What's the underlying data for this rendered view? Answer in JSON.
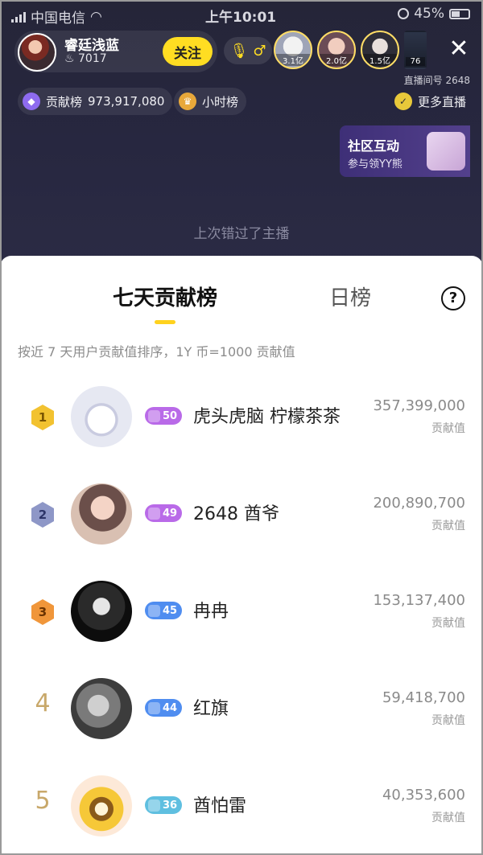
{
  "status_bar": {
    "carrier": "中国电信",
    "time": "上午10:01",
    "battery": "45%"
  },
  "anchor": {
    "name": "睿廷浅蓝",
    "fans": "7017",
    "follow_label": "关注"
  },
  "viewers": [
    {
      "score": "3.1亿"
    },
    {
      "score": "2.0亿"
    },
    {
      "score": "1.5亿"
    },
    {
      "score": "76"
    }
  ],
  "room_id": "直播间号 2648",
  "contribution": {
    "label": "贡献榜",
    "value": "973,917,080"
  },
  "hourly_label": "小时榜",
  "more_live_label": "更多直播",
  "promo": {
    "title": "社区互动",
    "subtitle": "参与领YY熊"
  },
  "missed_text": "上次错过了主播",
  "sheet": {
    "tab_weekly": "七天贡献榜",
    "tab_daily": "日榜",
    "help": "?",
    "description": "按近 7 天用户贡献值排序，1Y 币=1000 贡献值",
    "unit": "贡献值",
    "rows": [
      {
        "rank": "1",
        "level": "50",
        "name": "虎头虎脑 柠檬茶茶",
        "value": "357,399,000"
      },
      {
        "rank": "2",
        "level": "49",
        "name": "2648 酋爷",
        "value": "200,890,700"
      },
      {
        "rank": "3",
        "level": "45",
        "name": "冉冉",
        "value": "153,137,400"
      },
      {
        "rank": "4",
        "level": "44",
        "name": "红旗",
        "value": "59,418,700"
      },
      {
        "rank": "5",
        "level": "36",
        "name": "酋怕雷",
        "value": "40,353,600"
      }
    ]
  },
  "colors": {
    "accent_yellow": "#ffdd22",
    "gold_badge": "#f2c230",
    "silver_badge": "#8e97c7",
    "bronze_badge": "#f0963a",
    "level_purple": "#b96ae8",
    "level_blue": "#4f8df0",
    "level_teal": "#5fbfe0"
  }
}
